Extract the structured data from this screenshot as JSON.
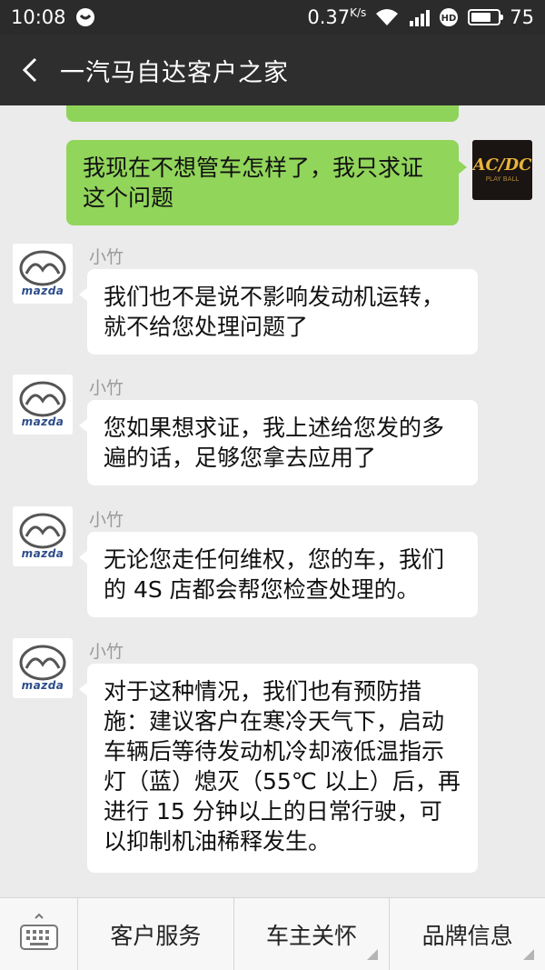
{
  "status_bar": {
    "time": "10:08",
    "network_speed": "0.37",
    "speed_unit": "K/s",
    "battery": "75",
    "battery_fraction": 0.75
  },
  "header": {
    "title": "一汽马自达客户之家"
  },
  "messages": {
    "outgoing": {
      "text": "我现在不想管车怎样了，我只求证这个问题",
      "avatar_text": "AC/DC",
      "avatar_sub": "PLAY BALL"
    },
    "incoming": [
      {
        "sender": "小竹",
        "text": "我们也不是说不影响发动机运转，就不给您处理问题了"
      },
      {
        "sender": "小竹",
        "text": "您如果想求证，我上述给您发的多遍的话，足够您拿去应用了"
      },
      {
        "sender": "小竹",
        "text": "无论您走任何维权，您的车，我们的 4S 店都会帮您检查处理的。"
      },
      {
        "sender": "小竹",
        "text": "对于这种情况，我们也有预防措施：建议客户在寒冷天气下，启动车辆后等待发动机冷却液低温指示灯（蓝）熄灭（55℃ 以上）后，再进行 15 分钟以上的日常行驶，可以抑制机油稀释发生。"
      }
    ],
    "avatar_brand": "mazda"
  },
  "menu": {
    "items": [
      "客户服务",
      "车主关怀",
      "品牌信息"
    ]
  },
  "colors": {
    "outgoing_bubble": "#91d55b",
    "incoming_bubble": "#ffffff",
    "title_bar": "#2e2e2e"
  }
}
